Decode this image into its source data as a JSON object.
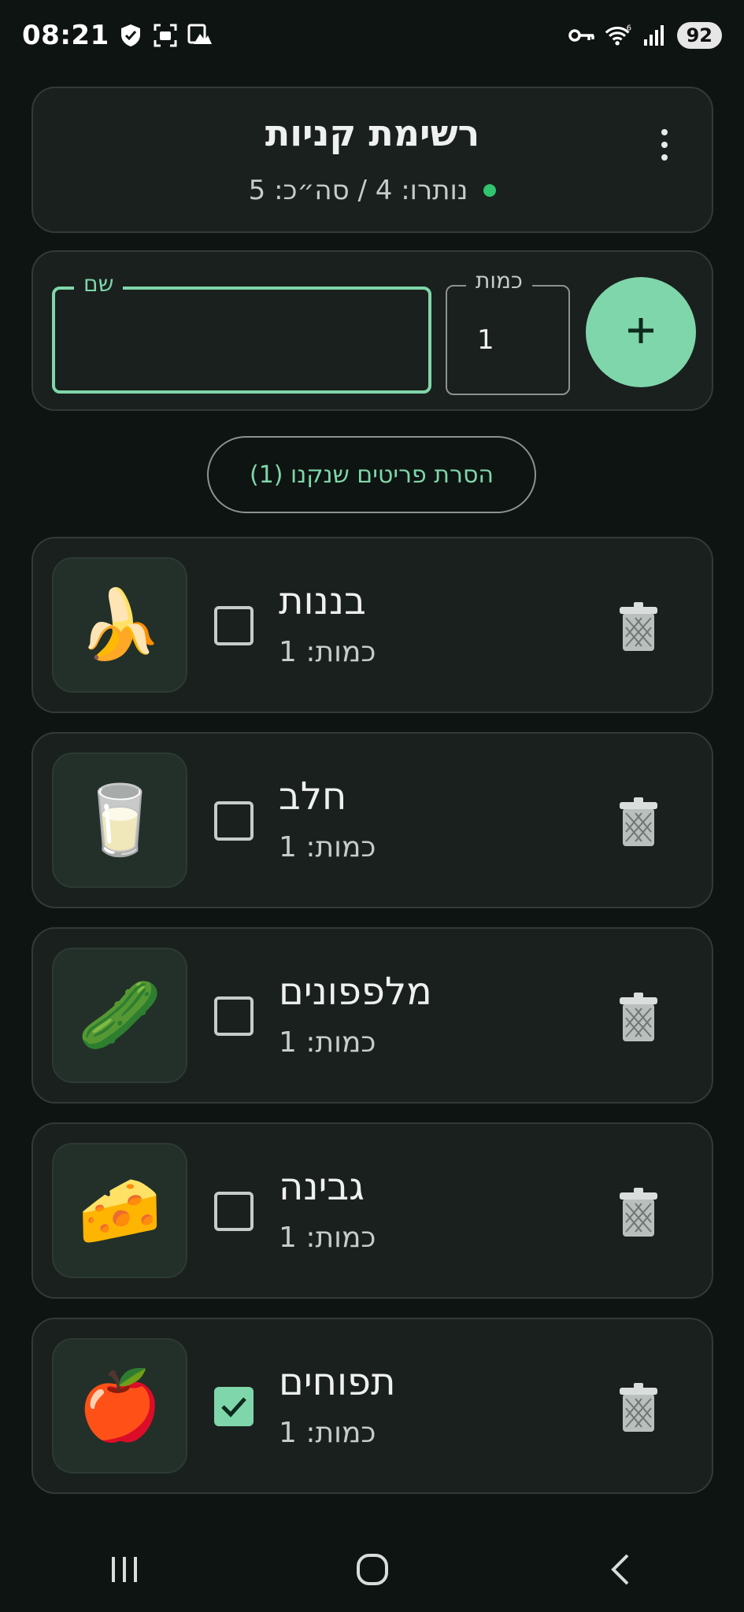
{
  "status": {
    "time": "08:21",
    "battery": "92",
    "icons": [
      "shield-icon",
      "screenshot-icon",
      "gallery-icon",
      "key-icon",
      "wifi-icon",
      "signal-icon"
    ]
  },
  "header": {
    "title": "רשימת קניות",
    "summary": "נותרו: 4 / סה״כ: 5",
    "menu_icon": "more-vert-icon"
  },
  "form": {
    "name_label": "שם",
    "name_value": "",
    "qty_label": "כמות",
    "qty_value": "1",
    "add_icon": "plus-icon"
  },
  "remove_purchased_label": "הסרת פריטים שנקנו (1)",
  "items": [
    {
      "name": "בננות",
      "qty": "כמות: 1",
      "emoji": "🍌",
      "checked": false
    },
    {
      "name": "חלב",
      "qty": "כמות: 1",
      "emoji": "🥛",
      "checked": false
    },
    {
      "name": "מלפפונים",
      "qty": "כמות: 1",
      "emoji": "🥒",
      "checked": false
    },
    {
      "name": "גבינה",
      "qty": "כמות: 1",
      "emoji": "🧀",
      "checked": false
    },
    {
      "name": "תפוחים",
      "qty": "כמות: 1",
      "emoji": "🍎",
      "checked": true
    }
  ],
  "colors": {
    "accent": "#7fd6aa",
    "background": "#0e1412",
    "card": "#1a201e",
    "status_dot": "#2fc46d"
  },
  "nav": [
    "recents-icon",
    "home-icon",
    "back-icon"
  ]
}
